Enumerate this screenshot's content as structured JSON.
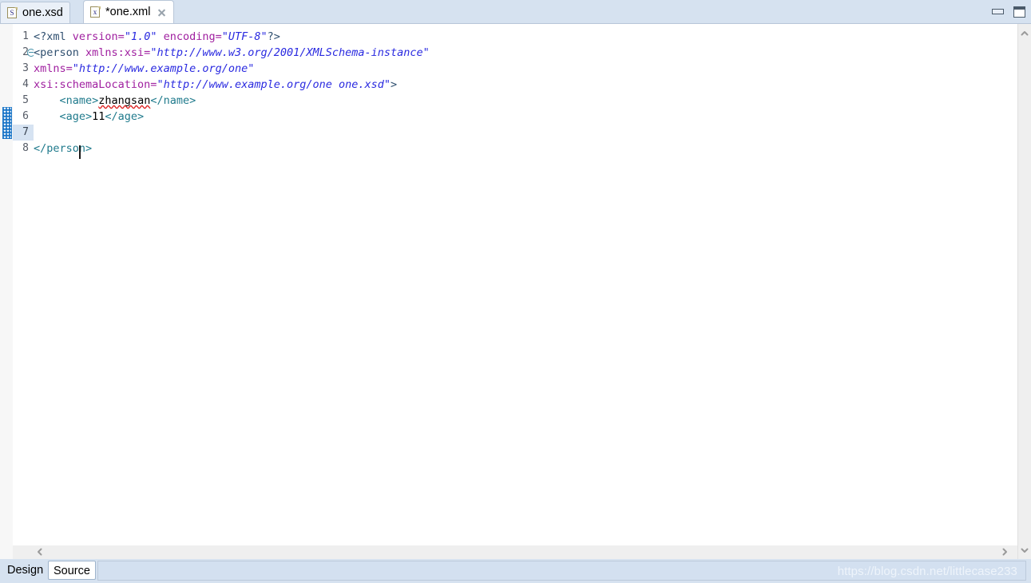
{
  "window": {
    "minimize_label": "Minimize",
    "maximize_label": "Maximize"
  },
  "tabs": [
    {
      "label": "one.xsd",
      "icon": "xsd-file-icon",
      "glyph": "S",
      "active": false,
      "closable": false
    },
    {
      "label": "*one.xml",
      "icon": "xml-file-icon",
      "glyph": "x",
      "active": true,
      "closable": true
    }
  ],
  "editor": {
    "language": "xml",
    "current_line": 7,
    "caret_column": 9,
    "modified": true,
    "line_numbers": [
      "1",
      "2",
      "3",
      "4",
      "5",
      "6",
      "7",
      "8"
    ],
    "fold_markers": [
      {
        "line": 2,
        "state": "expanded"
      }
    ],
    "change_bar_lines": [
      6,
      7
    ],
    "spellcheck_words": [
      "zhangsan"
    ],
    "lines": [
      {
        "number": "1",
        "tokens": [
          {
            "text": "<?xml ",
            "type": "proc"
          },
          {
            "text": "version=",
            "type": "attr"
          },
          {
            "text": "\"1.0\"",
            "type": "val"
          },
          {
            "text": " ",
            "type": "text"
          },
          {
            "text": "encoding=",
            "type": "attr"
          },
          {
            "text": "\"UTF-8\"",
            "type": "val"
          },
          {
            "text": "?>",
            "type": "proc"
          }
        ]
      },
      {
        "number": "2",
        "tokens": [
          {
            "text": "<person ",
            "type": "punct"
          },
          {
            "text": "xmlns:xsi=",
            "type": "attr"
          },
          {
            "text": "\"http://www.w3.org/2001/XMLSchema-instance\"",
            "type": "val"
          }
        ]
      },
      {
        "number": "3",
        "tokens": [
          {
            "text": "xmlns=",
            "type": "attr"
          },
          {
            "text": "\"http://www.example.org/one\"",
            "type": "val"
          }
        ]
      },
      {
        "number": "4",
        "tokens": [
          {
            "text": "xsi:schemaLocation=",
            "type": "attr"
          },
          {
            "text": "\"http://www.example.org/one one.xsd\"",
            "type": "val"
          },
          {
            "text": ">",
            "type": "punct"
          }
        ]
      },
      {
        "number": "5",
        "tokens": [
          {
            "text": "    ",
            "type": "text"
          },
          {
            "text": "<name>",
            "type": "tag"
          },
          {
            "text": "zhangsan",
            "type": "spell"
          },
          {
            "text": "</name>",
            "type": "tag"
          }
        ]
      },
      {
        "number": "6",
        "tokens": [
          {
            "text": "    ",
            "type": "text"
          },
          {
            "text": "<age>",
            "type": "tag"
          },
          {
            "text": "11",
            "type": "text"
          },
          {
            "text": "</age>",
            "type": "tag"
          }
        ]
      },
      {
        "number": "7",
        "tokens": [
          {
            "text": "        ",
            "type": "text"
          }
        ]
      },
      {
        "number": "8",
        "tokens": [
          {
            "text": "</person>",
            "type": "tag"
          }
        ]
      }
    ]
  },
  "scrollbars": {
    "vertical_up": "▲",
    "vertical_down": "▼",
    "horizontal_left": "◀",
    "horizontal_right": "▶"
  },
  "bottom": {
    "tabs": [
      {
        "label": "Design",
        "active": false
      },
      {
        "label": "Source",
        "active": true
      }
    ],
    "watermark": "https://blog.csdn.net/littlecase233"
  },
  "colors": {
    "tabbar_bg": "#d6e2f0",
    "active_tab_bg": "#ffffff",
    "current_line_highlight": "#d6e3f2",
    "change_bar": "#1f78c8",
    "tag": "#1f7a8c",
    "attr": "#a020a0",
    "value": "#2a2ae0",
    "punct": "#2f4f6f",
    "spell_underline": "#dd2222"
  }
}
